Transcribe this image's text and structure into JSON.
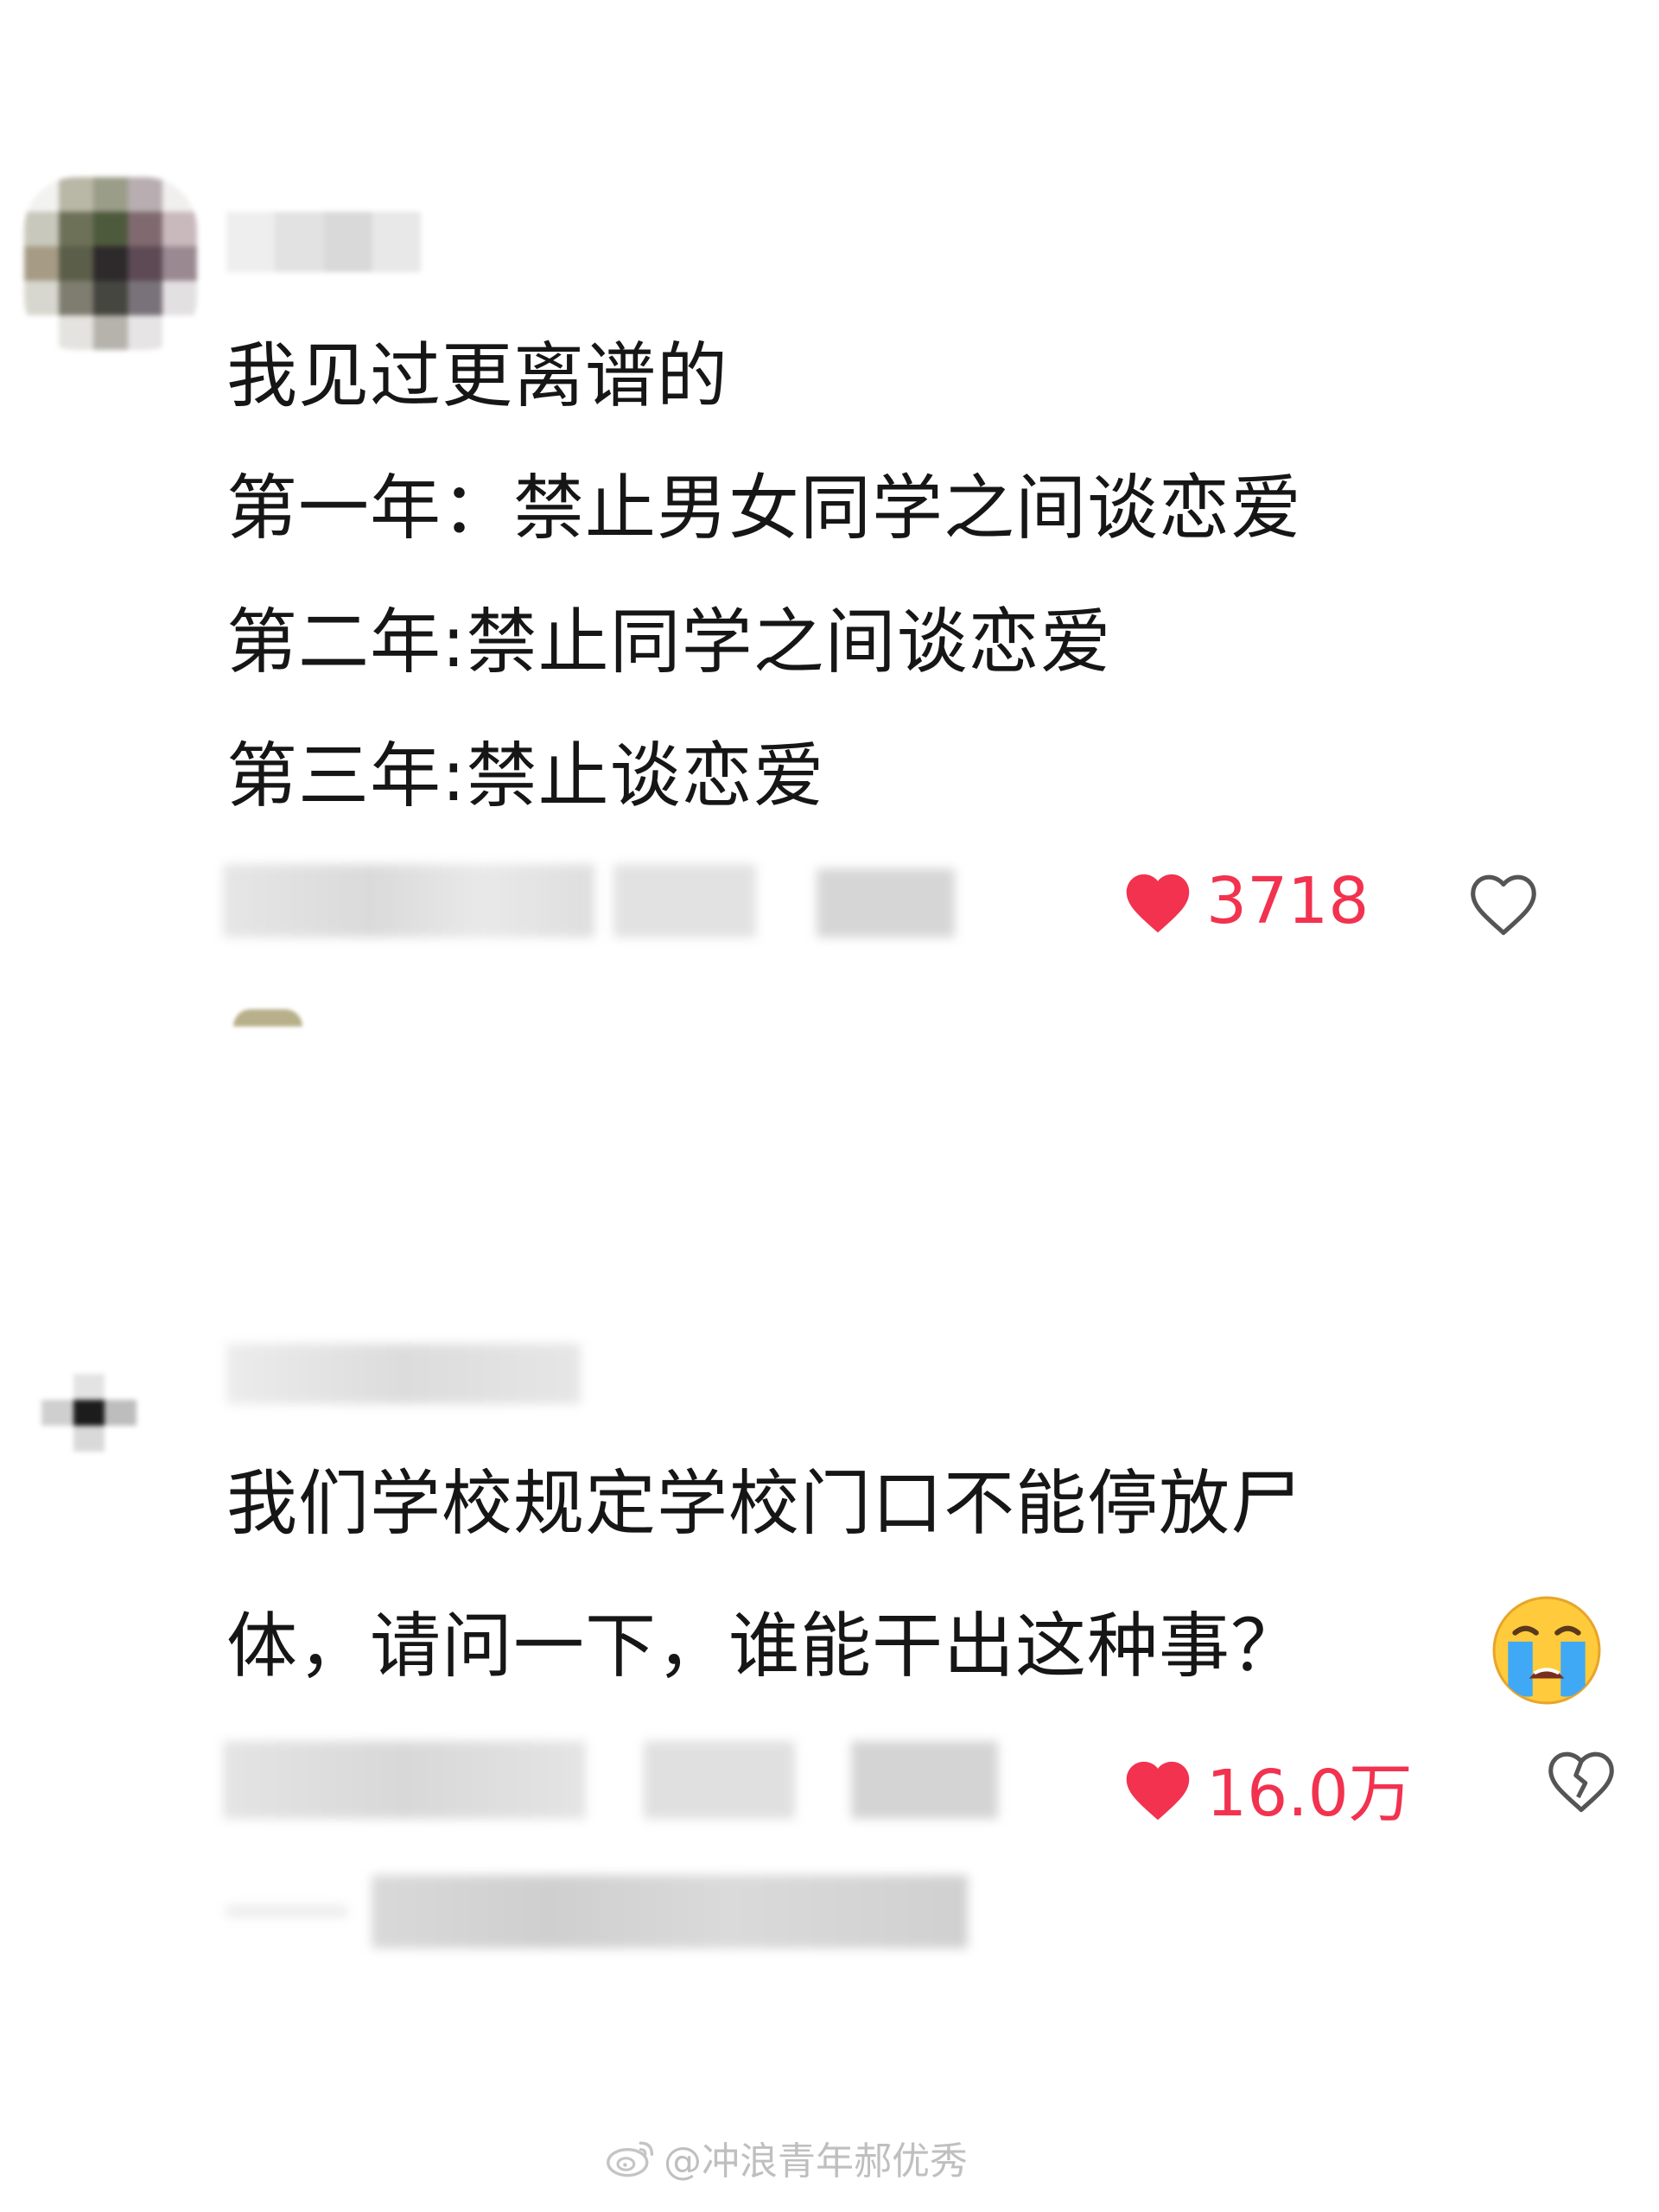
{
  "comments": [
    {
      "username": "",
      "lines": [
        "我见过更离谱的",
        "第一年：禁止男女同学之间谈恋爱",
        "第二年:禁止同学之间谈恋爱",
        "第三年:禁止谈恋爱"
      ],
      "likes": "3718",
      "like_icon": "heart-filled-icon",
      "dislike_icon": "heart-outline-icon"
    },
    {
      "username": "",
      "lines": [
        "我们学校规定学校门口不能停放尸",
        "体，请问一下，谁能干出这种事？"
      ],
      "emoji": "crying-face-icon",
      "likes": "16.0万",
      "like_icon": "heart-filled-icon",
      "dislike_icon": "broken-heart-icon"
    }
  ],
  "watermark": {
    "text": "@冲浪青年郝优秀",
    "icon": "weibo-logo-icon"
  },
  "colors": {
    "like_red": "#f2324f",
    "text": "#161616",
    "watermark": "#bfbfbf"
  }
}
